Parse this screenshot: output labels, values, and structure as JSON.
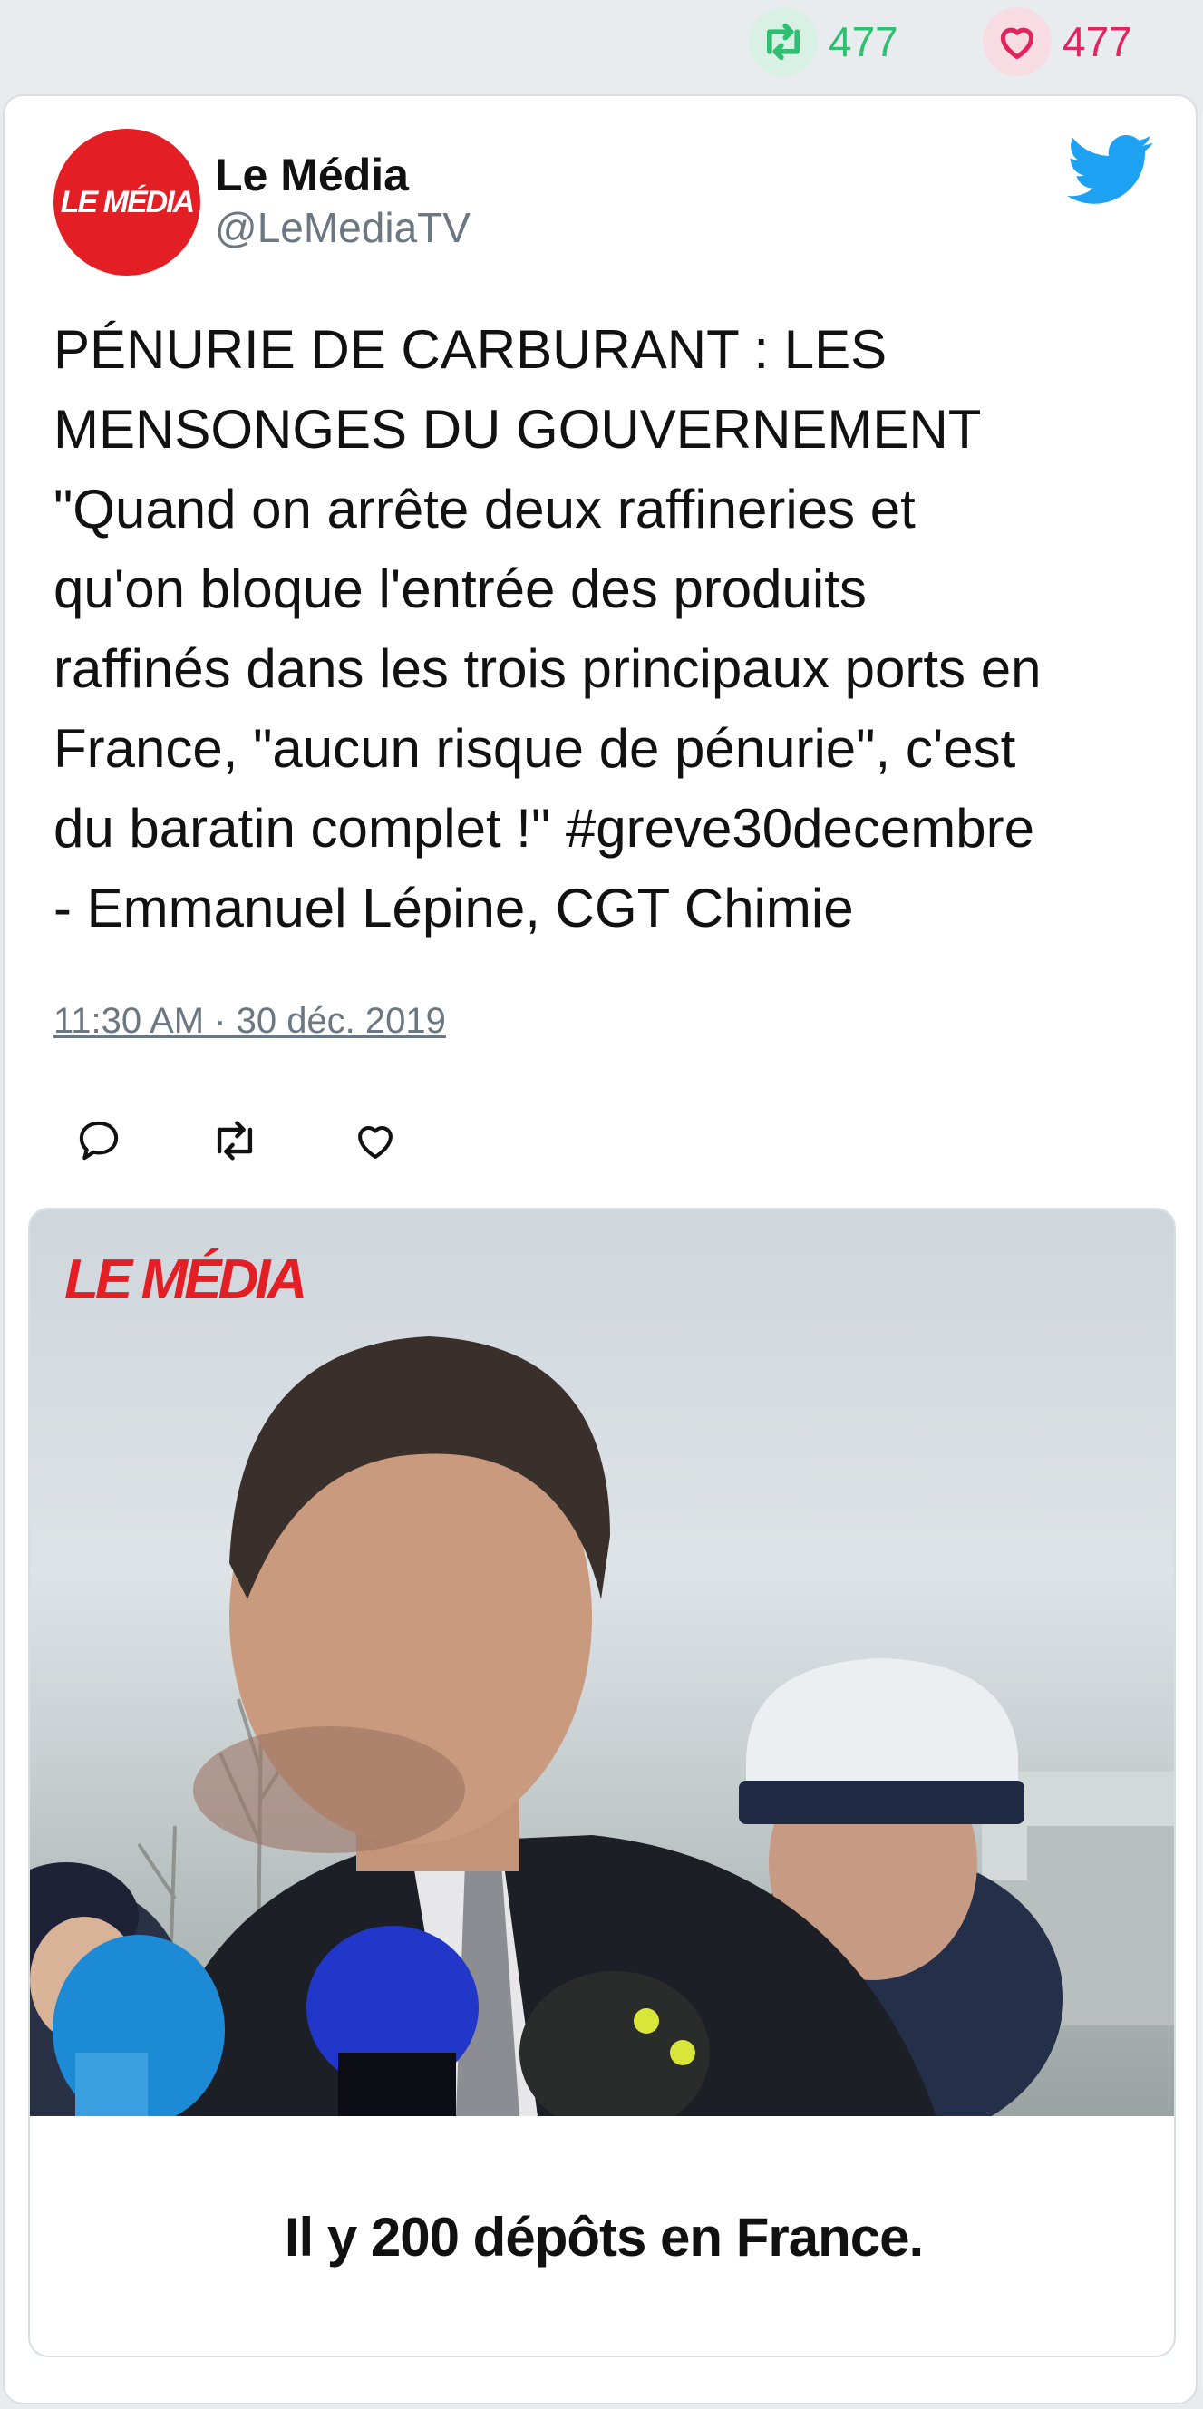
{
  "stats": {
    "retweets": "477",
    "likes": "477",
    "retweet_color": "#2fbf71",
    "like_color": "#e0245e"
  },
  "tweet": {
    "author_name": "Le Média",
    "author_handle": "@LeMediaTV",
    "avatar_text": "LE MÉDIA",
    "avatar_color": "#e31e24",
    "text_lines": [
      "PÉNURIE DE CARBURANT : LES",
      "MENSONGES DU GOUVERNEMENT",
      "\"Quand on arrête deux raffineries et",
      "qu'on bloque l'entrée des produits",
      "raffinés dans les trois principaux ports en",
      "France, \"aucun risque de pénurie\", c'est",
      "du baratin complet !\" #greve30decembre",
      "- Emmanuel Lépine, CGT Chimie"
    ],
    "timestamp": "11:30 AM · 30 déc. 2019",
    "icons": [
      "reply-icon",
      "retweet-icon",
      "like-icon",
      "twitter-bird-icon"
    ]
  },
  "media": {
    "logo_text": "LE MÉDIA",
    "caption": "Il y 200 dépôts en France."
  }
}
